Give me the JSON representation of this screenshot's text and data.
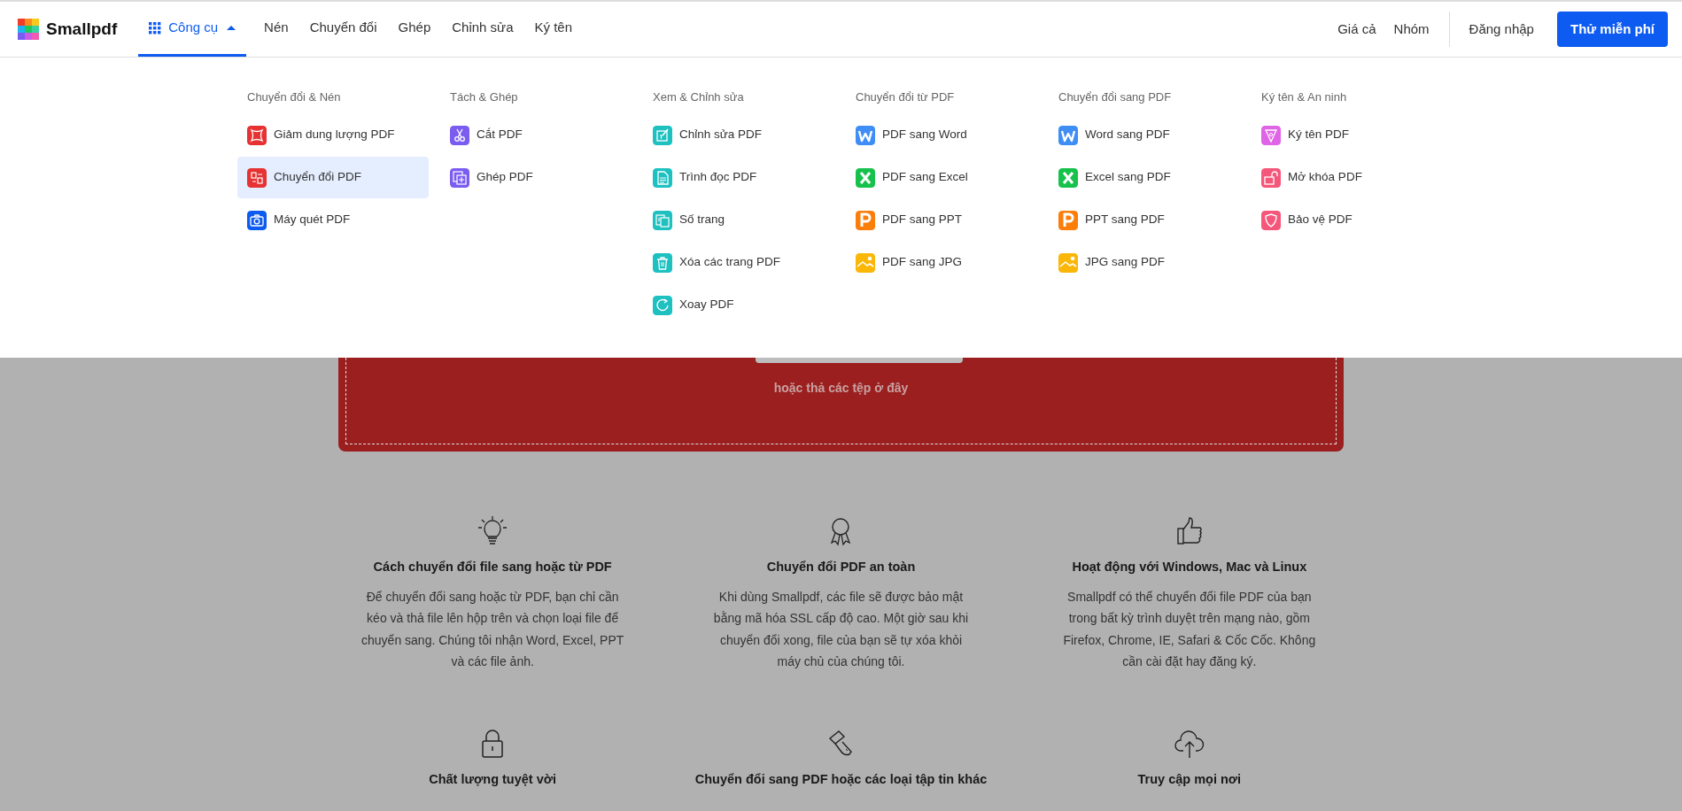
{
  "header": {
    "logo": "Smallpdf",
    "nav": [
      {
        "label": "Công cụ",
        "kind": "tools",
        "selected": true,
        "expanded": true
      },
      {
        "label": "Nén",
        "kind": "link",
        "selected": false
      },
      {
        "label": "Chuyển đổi",
        "kind": "link",
        "selected": false
      },
      {
        "label": "Ghép",
        "kind": "link",
        "selected": false
      },
      {
        "label": "Chỉnh sửa",
        "kind": "link",
        "selected": false
      },
      {
        "label": "Ký tên",
        "kind": "link",
        "selected": false
      }
    ],
    "right_links": [
      "Giá cả",
      "Nhóm"
    ],
    "login": "Đăng nhập",
    "cta": "Thử miễn phí"
  },
  "menu": {
    "columns": [
      {
        "heading": "Chuyển đổi & Nén",
        "items": [
          {
            "label": "Giảm dung lượng PDF",
            "kind": "compress",
            "color": "#e63232",
            "selected": false
          },
          {
            "label": "Chuyển đổi PDF",
            "kind": "convert",
            "color": "#e63232",
            "selected": true
          },
          {
            "label": "Máy quét PDF",
            "kind": "scan",
            "color": "#0d5bf0",
            "selected": false
          }
        ]
      },
      {
        "heading": "Tách & Ghép",
        "items": [
          {
            "label": "Cắt PDF",
            "kind": "split",
            "color": "#7b5cf0",
            "selected": false
          },
          {
            "label": "Ghép PDF",
            "kind": "merge",
            "color": "#7b5cf0",
            "selected": false
          }
        ]
      },
      {
        "heading": "Xem & Chỉnh sửa",
        "items": [
          {
            "label": "Chỉnh sửa PDF",
            "kind": "edit",
            "color": "#1ec0c0",
            "selected": false
          },
          {
            "label": "Trình đọc PDF",
            "kind": "reader",
            "color": "#1ec0c0",
            "selected": false
          },
          {
            "label": "Số trang",
            "kind": "numbers",
            "color": "#1ec0c0",
            "selected": false
          },
          {
            "label": "Xóa các trang PDF",
            "kind": "delete",
            "color": "#1ec0c0",
            "selected": false
          },
          {
            "label": "Xoay PDF",
            "kind": "rotate",
            "color": "#1ec0c0",
            "selected": false
          }
        ]
      },
      {
        "heading": "Chuyển đổi từ PDF",
        "items": [
          {
            "label": "PDF sang Word",
            "kind": "word",
            "color": "#3f8ef5",
            "selected": false
          },
          {
            "label": "PDF sang Excel",
            "kind": "excel",
            "color": "#16c24c",
            "selected": false
          },
          {
            "label": "PDF sang PPT",
            "kind": "ppt",
            "color": "#fb7d0a",
            "selected": false
          },
          {
            "label": "PDF sang JPG",
            "kind": "jpg",
            "color": "#fbb708",
            "selected": false
          }
        ]
      },
      {
        "heading": "Chuyển đổi sang PDF",
        "items": [
          {
            "label": "Word sang PDF",
            "kind": "word",
            "color": "#3f8ef5",
            "selected": false
          },
          {
            "label": "Excel sang PDF",
            "kind": "excel",
            "color": "#16c24c",
            "selected": false
          },
          {
            "label": "PPT sang PDF",
            "kind": "ppt",
            "color": "#fb7d0a",
            "selected": false
          },
          {
            "label": "JPG sang PDF",
            "kind": "jpg",
            "color": "#fbb708",
            "selected": false
          }
        ]
      },
      {
        "heading": "Ký tên & An ninh",
        "items": [
          {
            "label": "Ký tên PDF",
            "kind": "sign",
            "color": "#df64e6",
            "selected": false
          },
          {
            "label": "Mở khóa PDF",
            "kind": "unlock",
            "color": "#f5577a",
            "selected": false
          },
          {
            "label": "Bảo vệ PDF",
            "kind": "protect",
            "color": "#f5577a",
            "selected": false
          }
        ]
      }
    ]
  },
  "dropzone": {
    "hint": "hoặc thả các tệp ở đây"
  },
  "features": [
    {
      "kind": "bulb",
      "title": "Cách chuyển đổi file sang hoặc từ PDF",
      "text": "Để chuyển đổi sang hoặc từ PDF, bạn chỉ cần kéo và thả file lên hộp trên và chọn loại file để chuyển sang. Chúng tôi nhận Word, Excel, PPT và các file ảnh."
    },
    {
      "kind": "ribbon",
      "title": "Chuyển đổi PDF an toàn",
      "text": "Khi dùng Smallpdf, các file sẽ được bảo mật bằng mã hóa SSL cấp độ cao. Một giờ sau khi chuyển đổi xong, file của bạn sẽ tự xóa khỏi máy chủ của chúng tôi."
    },
    {
      "kind": "thumb",
      "title": "Hoạt động với Windows, Mac và Linux",
      "text": "Smallpdf có thể chuyển đổi file PDF của bạn trong bất kỳ trình duyệt trên mạng nào, gồm Firefox, Chrome, IE, Safari & Cốc Cốc. Không cần cài đặt hay đăng ký."
    },
    {
      "kind": "lock",
      "title": "Chất lượng tuyệt vời"
    },
    {
      "kind": "knife",
      "title": "Chuyển đổi sang PDF hoặc các loại tập tin khác"
    },
    {
      "kind": "cloud",
      "title": "Truy cập mọi nơi"
    }
  ]
}
